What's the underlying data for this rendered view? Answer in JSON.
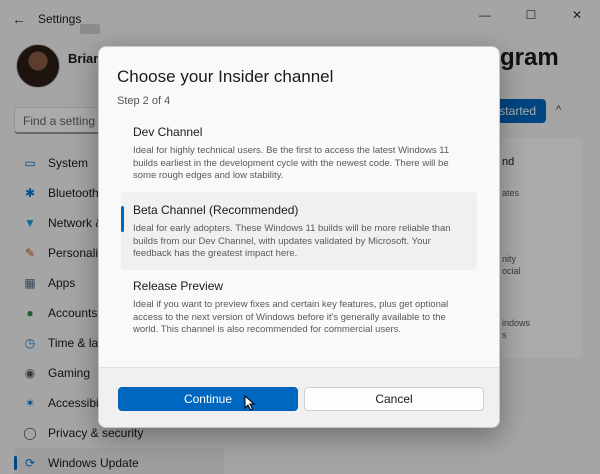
{
  "window": {
    "title": "Settings"
  },
  "profile": {
    "name": "Brian E"
  },
  "search": {
    "placeholder": "Find a setting"
  },
  "sidebar": {
    "items": [
      {
        "label": "System",
        "icon": "monitor-icon"
      },
      {
        "label": "Bluetooth &",
        "icon": "bluetooth-icon"
      },
      {
        "label": "Network &",
        "icon": "wifi-icon"
      },
      {
        "label": "Personaliz",
        "icon": "brush-icon"
      },
      {
        "label": "Apps",
        "icon": "apps-icon"
      },
      {
        "label": "Accounts",
        "icon": "person-icon"
      },
      {
        "label": "Time & lang",
        "icon": "clock-icon"
      },
      {
        "label": "Gaming",
        "icon": "gamepad-icon"
      },
      {
        "label": "Accessibil",
        "icon": "accessibility-icon"
      },
      {
        "label": "Privacy & security",
        "icon": "shield-icon"
      },
      {
        "label": "Windows Update",
        "icon": "update-icon"
      }
    ]
  },
  "right_panel": {
    "heading": "gram",
    "get_started": "t started",
    "fragments": [
      "nd",
      "ates",
      "nity",
      "ocial",
      "indows",
      "s"
    ]
  },
  "dialog": {
    "title": "Choose your Insider channel",
    "step": "Step 2 of 4",
    "options": [
      {
        "title": "Dev Channel",
        "description": "Ideal for highly technical users. Be the first to access the latest Windows 11 builds earliest in the development cycle with the newest code. There will be some rough edges and low stability.",
        "selected": false
      },
      {
        "title": "Beta Channel (Recommended)",
        "description": "Ideal for early adopters. These Windows 11 builds will be more reliable than builds from our Dev Channel, with updates validated by Microsoft. Your feedback has the greatest impact here.",
        "selected": true
      },
      {
        "title": "Release Preview",
        "description": "Ideal if you want to preview fixes and certain key features, plus get optional access to the next version of Windows before it's generally available to the world. This channel is also recommended for commercial users.",
        "selected": false
      }
    ],
    "continue_label": "Continue",
    "cancel_label": "Cancel"
  },
  "colors": {
    "accent": "#0067c0",
    "background": "#f3f3f3",
    "dialog": "#f9f9f9"
  }
}
